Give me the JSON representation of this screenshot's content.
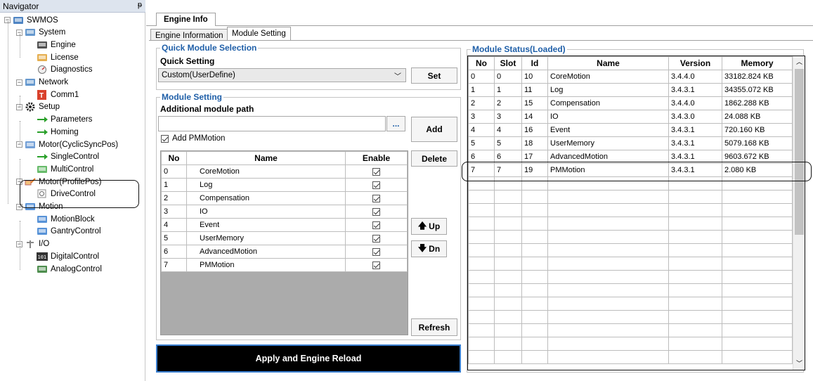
{
  "navigator": {
    "title": "Navigator",
    "pin": "ᵽ",
    "tree": [
      {
        "label": "SWMOS",
        "icon": "monitor-icon",
        "level": 0,
        "expander": "−"
      },
      {
        "label": "System",
        "icon": "system-icon",
        "level": 1,
        "expander": "−"
      },
      {
        "label": "Engine",
        "icon": "engine-icon",
        "level": 2
      },
      {
        "label": "License",
        "icon": "license-icon",
        "level": 2
      },
      {
        "label": "Diagnostics",
        "icon": "diagnostics-icon",
        "level": 2
      },
      {
        "label": "Network",
        "icon": "network-icon",
        "level": 1,
        "expander": "−"
      },
      {
        "label": "Comm1",
        "icon": "comm-icon",
        "level": 2
      },
      {
        "label": "Setup",
        "icon": "gear-icon",
        "level": 1,
        "expander": "−"
      },
      {
        "label": "Parameters",
        "icon": "arrow-right-icon",
        "level": 2
      },
      {
        "label": "Homing",
        "icon": "arrow-right-icon",
        "level": 2
      },
      {
        "label": "Motor(CyclicSyncPos)",
        "icon": "motor-icon",
        "level": 1,
        "expander": "−"
      },
      {
        "label": "SingleControl",
        "icon": "arrow-right-icon",
        "level": 2
      },
      {
        "label": "MultiControl",
        "icon": "multi-icon",
        "level": 2
      },
      {
        "label": "Motor(ProfilePos)",
        "icon": "motor-profile-icon",
        "level": 1,
        "expander": "−"
      },
      {
        "label": "DriveControl",
        "icon": "drive-icon",
        "level": 2
      },
      {
        "label": "Motion",
        "icon": "motion-icon",
        "level": 1,
        "expander": "−"
      },
      {
        "label": "MotionBlock",
        "icon": "motion-block-icon",
        "level": 2
      },
      {
        "label": "GantryControl",
        "icon": "gantry-icon",
        "level": 2
      },
      {
        "label": "I/O",
        "icon": "io-icon",
        "level": 1,
        "expander": "−"
      },
      {
        "label": "DigitalControl",
        "icon": "digital-icon",
        "level": 2
      },
      {
        "label": "AnalogControl",
        "icon": "analog-icon",
        "level": 2
      }
    ]
  },
  "tabs": {
    "main": "Engine Info",
    "sub": [
      "Engine Information",
      "Module Setting"
    ]
  },
  "quick_module": {
    "group_title": "Quick Module Selection",
    "label": "Quick Setting",
    "selected": "Custom(UserDefine)",
    "set_label": "Set"
  },
  "module_setting": {
    "group_title": "Module Setting",
    "path_label": "Additional module path",
    "path_value": "",
    "browse_label": "...",
    "add_pm_label": "Add PMMotion",
    "add_label": "Add",
    "delete_label": "Delete",
    "up_label": "Up",
    "dn_label": "Dn",
    "refresh_label": "Refresh",
    "columns": [
      "No",
      "Name",
      "Enable"
    ],
    "rows": [
      {
        "no": "0",
        "name": "CoreMotion"
      },
      {
        "no": "1",
        "name": "Log"
      },
      {
        "no": "2",
        "name": "Compensation"
      },
      {
        "no": "3",
        "name": "IO"
      },
      {
        "no": "4",
        "name": "Event"
      },
      {
        "no": "5",
        "name": "UserMemory"
      },
      {
        "no": "6",
        "name": "AdvancedMotion"
      },
      {
        "no": "7",
        "name": "PMMotion"
      }
    ],
    "apply_label": "Apply and Engine Reload"
  },
  "module_status": {
    "group_title": "Module Status(Loaded)",
    "columns": [
      "No",
      "Slot",
      "Id",
      "Name",
      "Version",
      "Memory"
    ],
    "rows": [
      [
        "0",
        "0",
        "10",
        "CoreMotion",
        "3.4.4.0",
        "33182.824 KB"
      ],
      [
        "1",
        "1",
        "11",
        "Log",
        "3.4.3.1",
        "34355.072 KB"
      ],
      [
        "2",
        "2",
        "15",
        "Compensation",
        "3.4.4.0",
        "1862.288 KB"
      ],
      [
        "3",
        "3",
        "14",
        "IO",
        "3.4.3.0",
        "24.088 KB"
      ],
      [
        "4",
        "4",
        "16",
        "Event",
        "3.4.3.1",
        "720.160 KB"
      ],
      [
        "5",
        "5",
        "18",
        "UserMemory",
        "3.4.3.1",
        "5079.168 KB"
      ],
      [
        "6",
        "6",
        "17",
        "AdvancedMotion",
        "3.4.3.1",
        "9603.672 KB"
      ],
      [
        "7",
        "7",
        "19",
        "PMMotion",
        "3.4.3.1",
        "2.080 KB"
      ]
    ],
    "empty_rows": 14
  }
}
